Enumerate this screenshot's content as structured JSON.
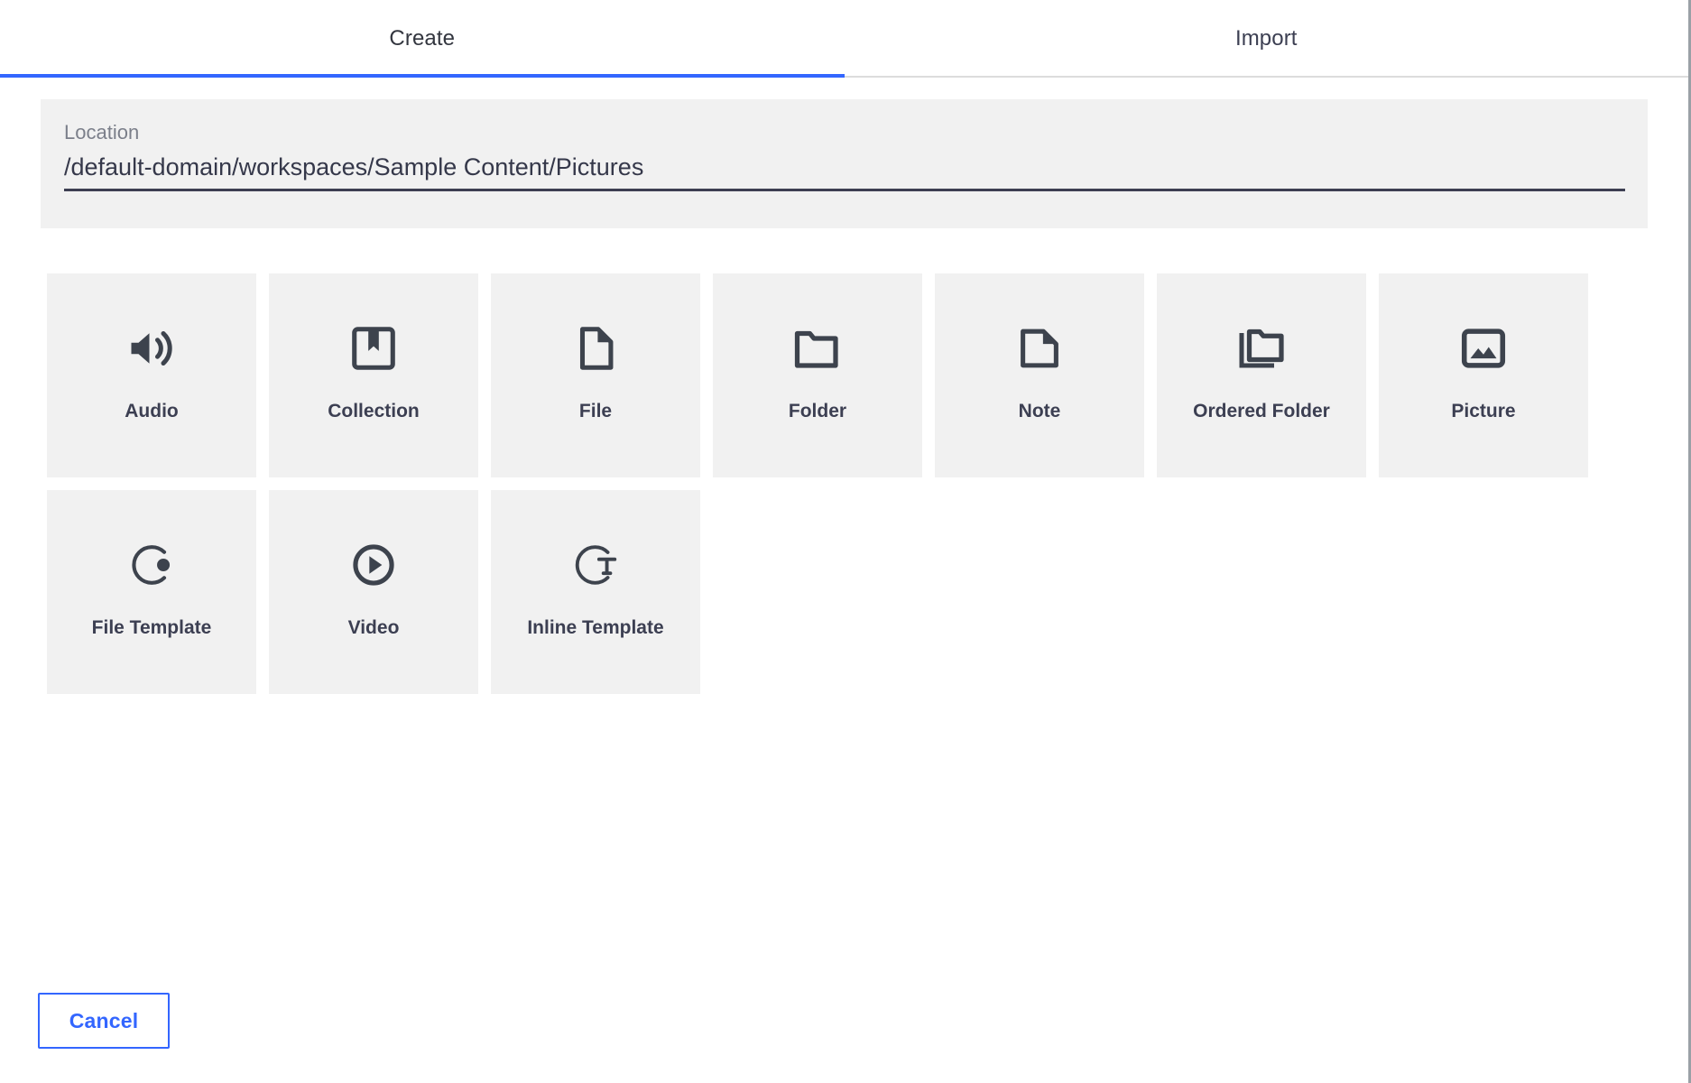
{
  "tabs": [
    {
      "label": "Create",
      "active": true
    },
    {
      "label": "Import",
      "active": false
    }
  ],
  "location": {
    "label": "Location",
    "value": "/default-domain/workspaces/Sample Content/Pictures",
    "placeholder": "/default-domain/workspaces/Sample Content/Pictures"
  },
  "doc_types": [
    {
      "label": "Audio",
      "icon": "audio-speaker-icon"
    },
    {
      "label": "Collection",
      "icon": "collection-bookmark-icon"
    },
    {
      "label": "File",
      "icon": "file-document-icon"
    },
    {
      "label": "Folder",
      "icon": "folder-icon"
    },
    {
      "label": "Note",
      "icon": "note-icon"
    },
    {
      "label": "Ordered Folder",
      "icon": "ordered-folder-icon"
    },
    {
      "label": "Picture",
      "icon": "picture-image-icon"
    },
    {
      "label": "File Template",
      "icon": "file-template-circle-icon"
    },
    {
      "label": "Video",
      "icon": "video-play-icon"
    },
    {
      "label": "Inline Template",
      "icon": "inline-template-text-icon"
    }
  ],
  "footer": {
    "cancel_label": "Cancel"
  },
  "colors": {
    "accent": "#3366ff",
    "tile_bg": "#f1f1f1",
    "text": "#3c3f52",
    "muted": "#7b7f8a",
    "icon": "#3d434d"
  }
}
